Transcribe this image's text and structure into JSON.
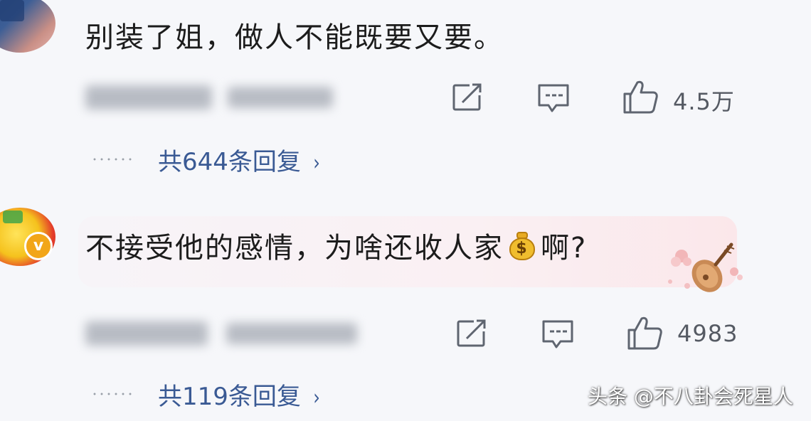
{
  "comments": [
    {
      "text": "别装了姐，做人不能既要又要。",
      "likes": "4.5万",
      "replies": "共644条回复",
      "icons": [
        "repost-icon",
        "comment-icon",
        "like-icon"
      ]
    },
    {
      "text_before": "不接受他的感情，为啥还收人家",
      "emoji": "money-bag-icon",
      "emoji_glyph": "$",
      "text_after": "啊?",
      "likes": "4983",
      "replies": "共119条回复",
      "badge_glyph": "v",
      "icons": [
        "repost-icon",
        "comment-icon",
        "like-icon"
      ]
    }
  ],
  "chevron": "›",
  "watermark": "头条 @不八卦会死星人",
  "colors": {
    "background": "#f6f7fa",
    "text": "#1c1c1c",
    "link": "#3a5a94",
    "icon": "#5f6570"
  }
}
